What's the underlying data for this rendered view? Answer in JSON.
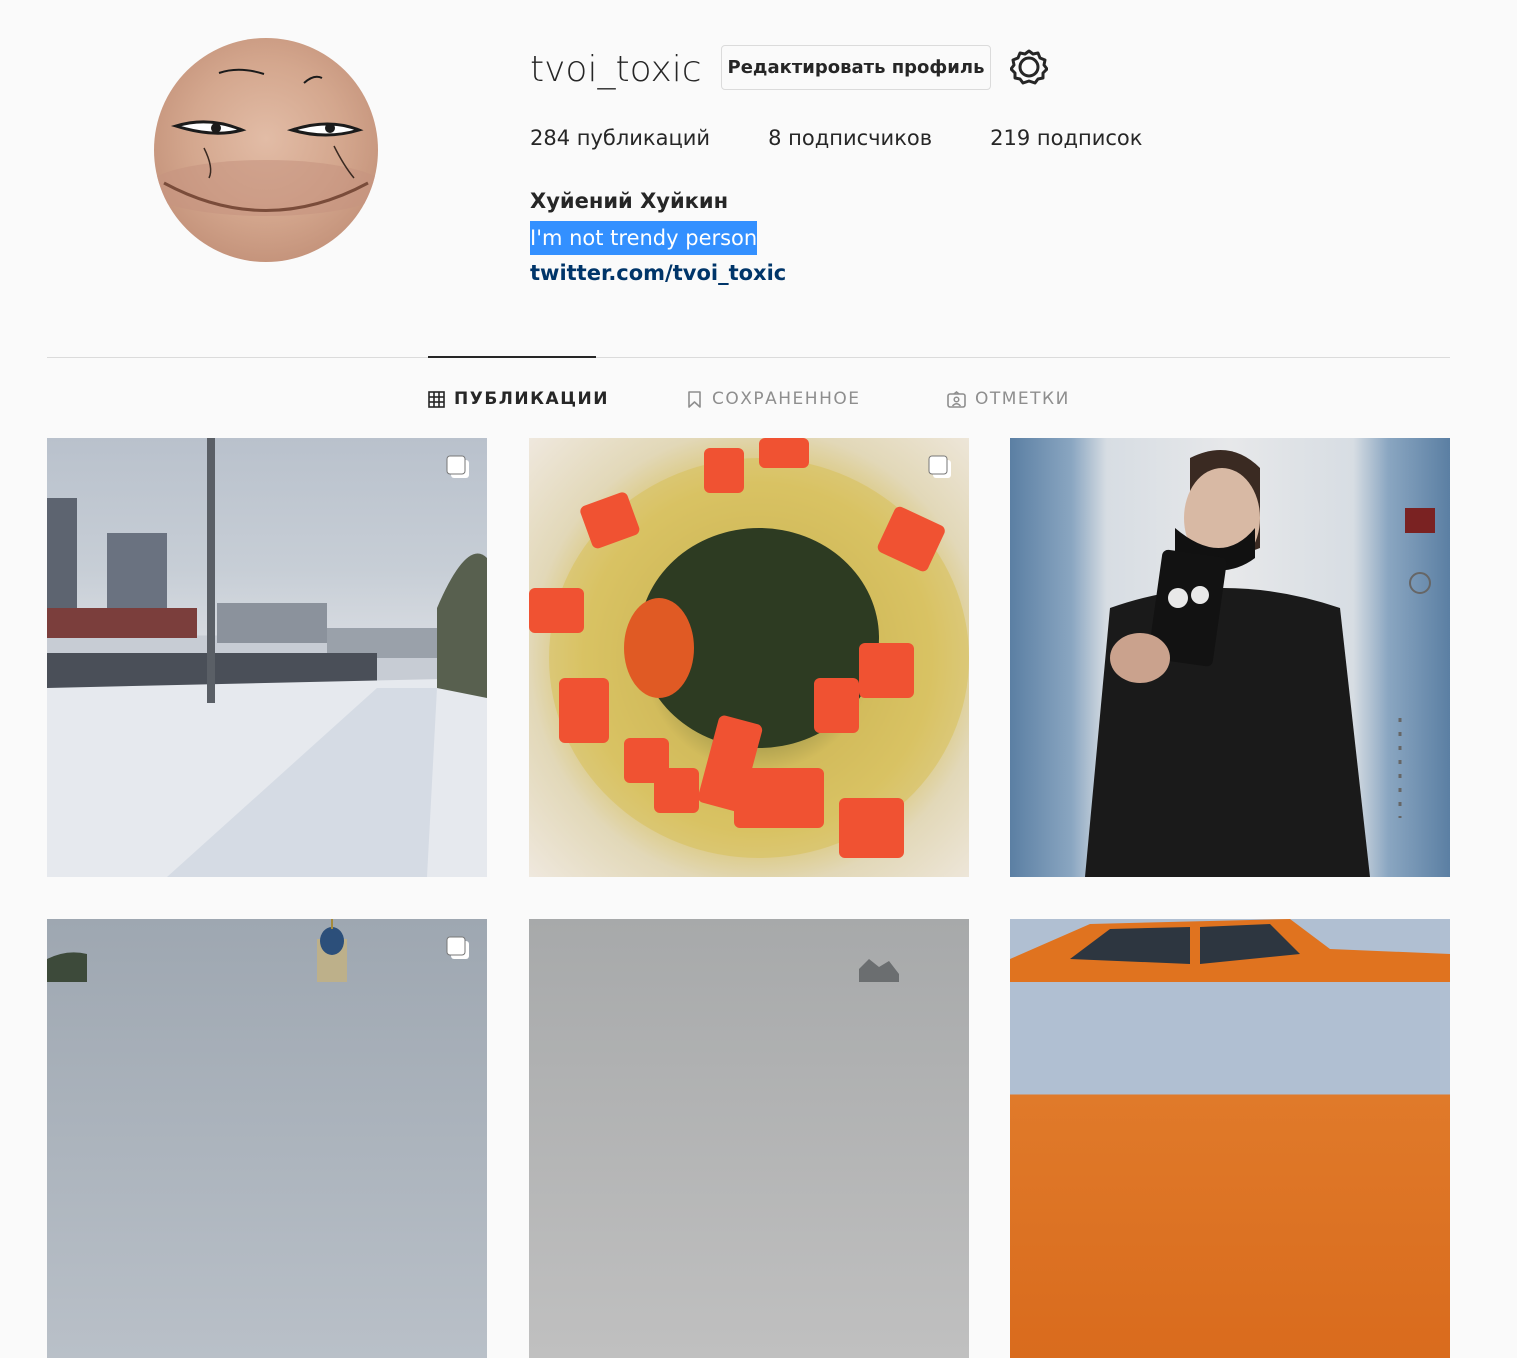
{
  "profile": {
    "username": "tvoi_toxic",
    "edit_button": "Редактировать профиль",
    "stats": {
      "posts": "284 публикаций",
      "followers": "8 подписчиков",
      "following": "219 подписок"
    },
    "full_name": "Хуйений Хуйкин",
    "bio": "I'm not trendy person",
    "link": "twitter.com/tvoi_toxic"
  },
  "tabs": [
    {
      "label": "ПУБЛИКАЦИИ",
      "icon": "grid-icon",
      "active": true
    },
    {
      "label": "СОХРАНЕННОЕ",
      "icon": "bookmark-icon",
      "active": false
    },
    {
      "label": "ОТМЕТКИ",
      "icon": "tagged-user-icon",
      "active": false
    }
  ],
  "colors": {
    "background": "#fafafa",
    "text": "#262626",
    "muted": "#8e8e8e",
    "link": "#003569",
    "selection": "#3390ff"
  }
}
